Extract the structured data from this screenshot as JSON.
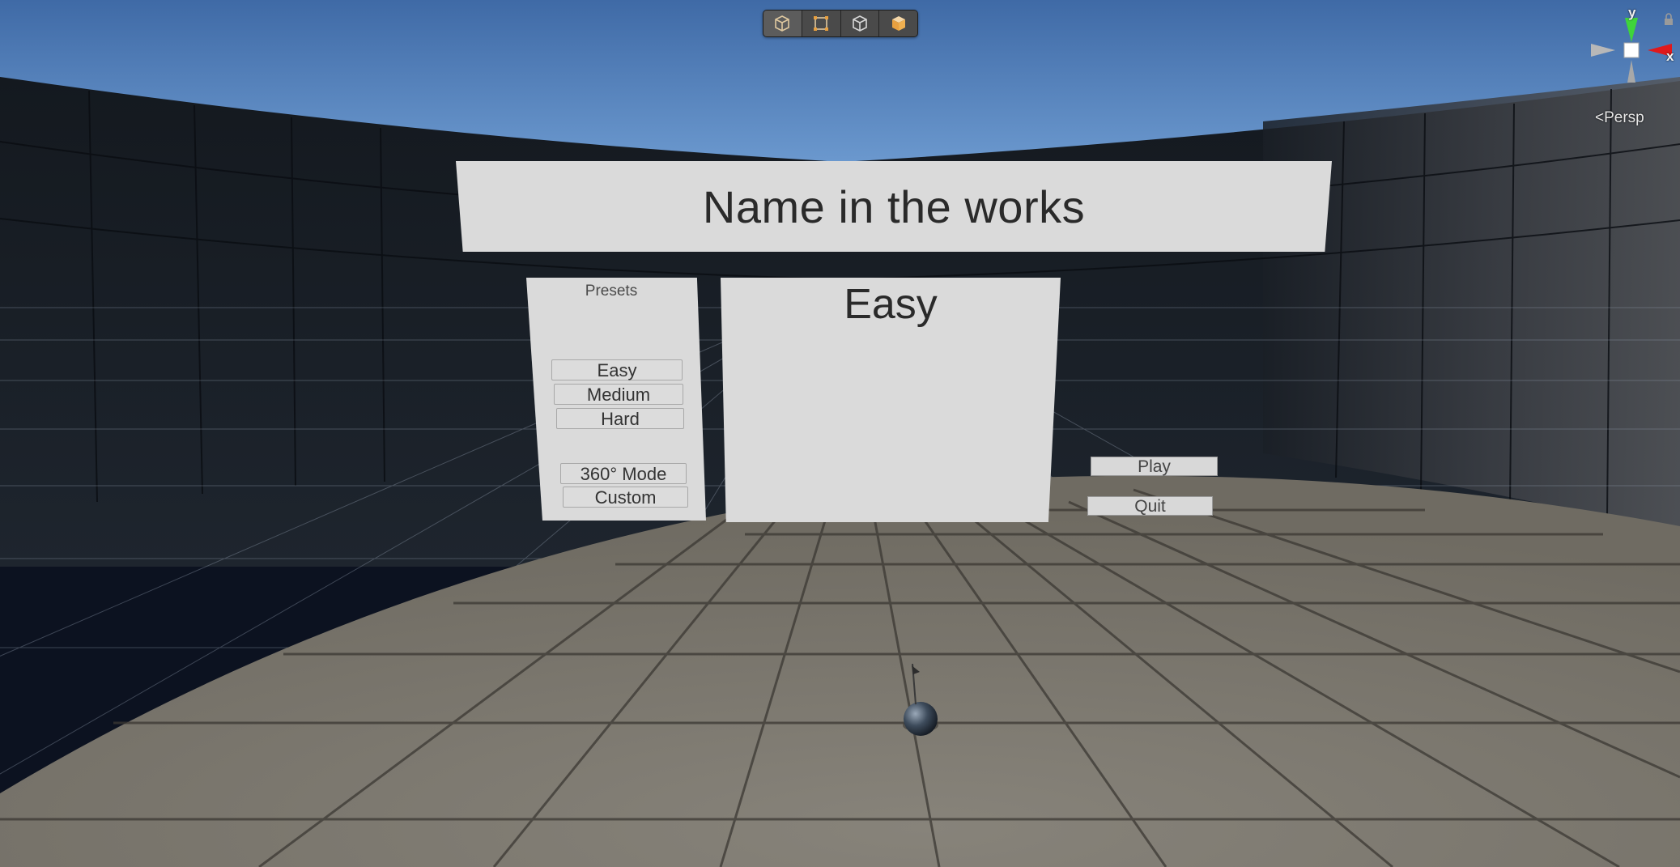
{
  "toolbar": {
    "tools": [
      {
        "icon": "cube-icon",
        "active": true
      },
      {
        "icon": "rect-tool-icon",
        "active": false
      },
      {
        "icon": "cube-icon",
        "active": false
      },
      {
        "icon": "orange-cube-icon",
        "active": false
      }
    ]
  },
  "gizmo": {
    "y_label": "y",
    "x_label": "x",
    "view_mode": "Persp"
  },
  "menu": {
    "title": "Name in the works",
    "presets": {
      "heading": "Presets",
      "easy": "Easy",
      "medium": "Medium",
      "hard": "Hard",
      "mode_360": "360° Mode",
      "custom": "Custom"
    },
    "selected_preset": "Easy",
    "play_label": "Play",
    "quit_label": "Quit"
  },
  "colors": {
    "sky_top": "#3f6aa6",
    "sky_bottom": "#6d9bd2",
    "floor": "#7c786d",
    "panel": "#dadada",
    "gizmo_y": "#3fd43a",
    "gizmo_x": "#e0191b"
  }
}
